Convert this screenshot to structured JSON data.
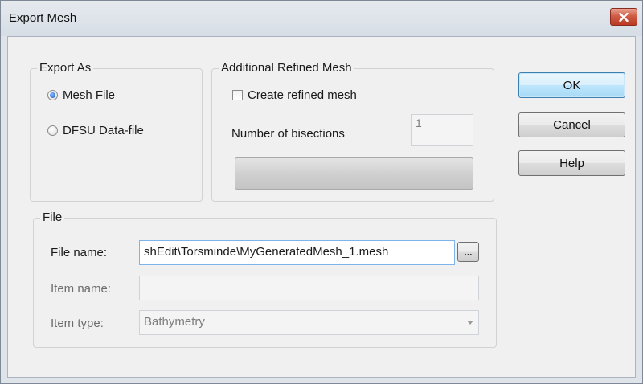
{
  "window": {
    "title": "Export Mesh"
  },
  "export_as": {
    "legend": "Export As",
    "options": [
      {
        "label": "Mesh File",
        "checked": true
      },
      {
        "label": "DFSU Data-file",
        "checked": false
      }
    ]
  },
  "refined": {
    "legend": "Additional Refined Mesh",
    "create_label": "Create refined mesh",
    "create_checked": false,
    "bisections_label": "Number of bisections",
    "bisections_value": "1"
  },
  "file": {
    "legend": "File",
    "file_name_label": "File name:",
    "file_name_value": "shEdit\\Torsminde\\MyGeneratedMesh_1.mesh",
    "browse_label": "...",
    "item_name_label": "Item name:",
    "item_name_value": "",
    "item_type_label": "Item type:",
    "item_type_value": "Bathymetry"
  },
  "buttons": {
    "ok": "OK",
    "cancel": "Cancel",
    "help": "Help"
  },
  "colors": {
    "close_button": "#c7432b",
    "default_button_border": "#3c7fb1"
  }
}
